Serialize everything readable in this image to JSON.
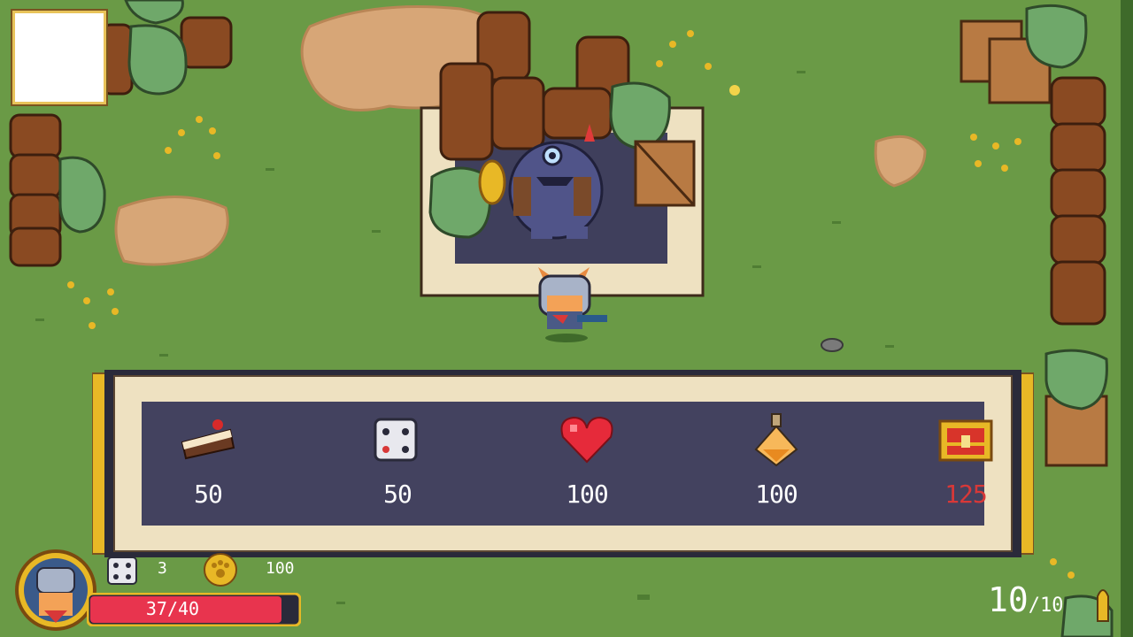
{
  "shop": {
    "items": [
      {
        "name": "cake-slice",
        "price": "50",
        "affordable": true
      },
      {
        "name": "dice",
        "price": "50",
        "affordable": true
      },
      {
        "name": "heart",
        "price": "100",
        "affordable": true
      },
      {
        "name": "potion",
        "price": "100",
        "affordable": true
      },
      {
        "name": "treasure-chest",
        "price": "125",
        "affordable": false
      }
    ]
  },
  "hud": {
    "health": "37/40",
    "health_fraction": 0.925,
    "dice_count": "3",
    "coin_count": "100",
    "ammo_current": "10",
    "ammo_max": "/10"
  },
  "icons": {
    "minimap": "minimap-panel",
    "portrait": "corgi-knight-portrait",
    "dice_hud": "dice-icon",
    "coin_hud": "paw-coin-icon",
    "ammo": "bullet-icon"
  },
  "colors": {
    "grass": "#6a9a46",
    "panel_bg": "#eee1c1",
    "slot_bg": "#43425f",
    "price_text": "#ffffff",
    "price_unaffordable": "#d83838",
    "hp_fill": "#e8344e",
    "gold_trim": "#e8b826"
  }
}
